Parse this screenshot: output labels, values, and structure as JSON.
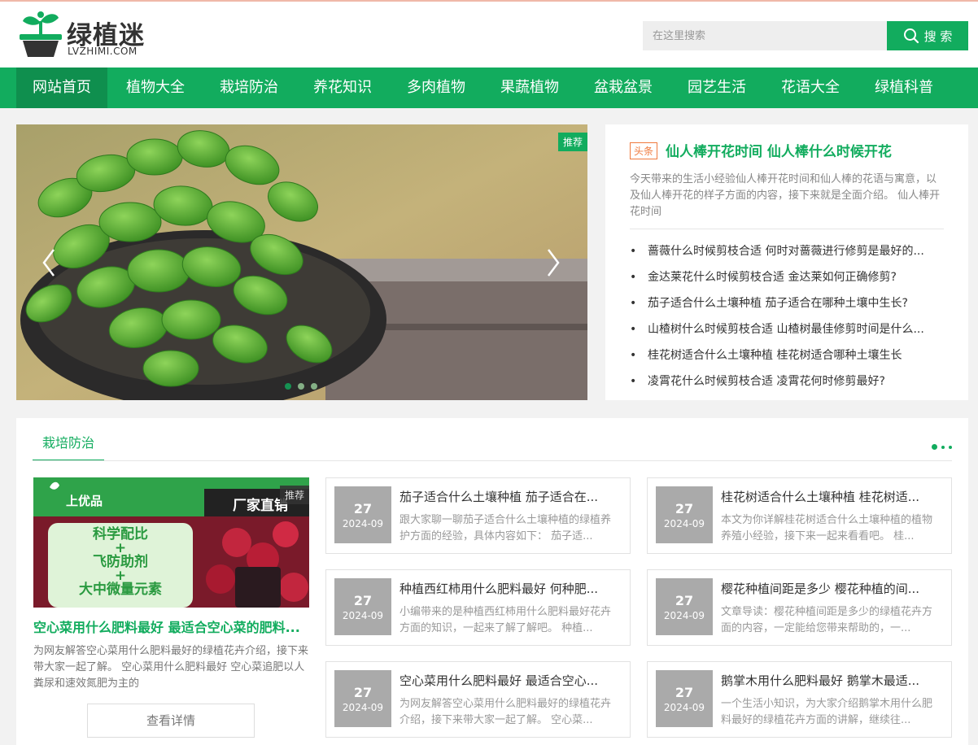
{
  "brand": {
    "name": "绿植迷",
    "domain": "LVZHIMI.COM",
    "accent": "#12ac5e",
    "logo_icon": "sprout-pot-icon"
  },
  "search": {
    "placeholder": "在这里搜索",
    "button_label": "搜 索"
  },
  "nav": {
    "items": [
      {
        "label": "网站首页",
        "active": true
      },
      {
        "label": "植物大全"
      },
      {
        "label": "栽培防治"
      },
      {
        "label": "养花知识"
      },
      {
        "label": "多肉植物"
      },
      {
        "label": "果蔬植物"
      },
      {
        "label": "盆栽盆景"
      },
      {
        "label": "园艺生活"
      },
      {
        "label": "花语大全"
      },
      {
        "label": "绿植科普"
      }
    ]
  },
  "slider": {
    "badge": "推荐",
    "image": "mint-plant-in-pot",
    "prev_icon": "chevron-left-icon",
    "next_icon": "chevron-right-icon"
  },
  "headline": {
    "badge": "头条",
    "title": "仙人棒开花时间 仙人棒什么时候开花",
    "summary": "今天带来的生活小经验仙人棒开花时间和仙人棒的花语与寓意，以及仙人棒开花的样子方面的内容，接下来就是全面介绍。 仙人棒开花时间",
    "list": [
      "蔷薇什么时候剪枝合适 何时对蔷薇进行修剪是最好的...",
      "金达莱花什么时候剪枝合适 金达莱如何正确修剪?",
      "茄子适合什么土壤种植 茄子适合在哪种土壤中生长?",
      "山楂树什么时候剪枝合适 山楂树最佳修剪时间是什么...",
      "桂花树适合什么土壤种植 桂花树适合哪种土壤生长",
      "凌霄花什么时候剪枝合适 凌霄花何时修剪最好?"
    ]
  },
  "section": {
    "tab": "栽培防治",
    "feature": {
      "badge": "推荐",
      "image_brand": "上优品",
      "image_tag": "厂家直销",
      "image_lines": [
        "科学配比",
        "+",
        "飞防助剂",
        "+",
        "大中微量元素"
      ],
      "title": "空心菜用什么肥料最好 最适合空心菜的肥料...",
      "desc": "为网友解答空心菜用什么肥料最好的绿植花卉介绍，接下来带大家一起了解。 空心菜用什么肥料最好 空心菜追肥以人粪尿和速效氮肥为主的",
      "button": "查看详情"
    },
    "cards": [
      {
        "day": "27",
        "ym": "2024-09",
        "title": "茄子适合什么土壤种植 茄子适合在...",
        "desc": "跟大家聊一聊茄子适合什么土壤种植的绿植养护方面的经验，具体内容如下： 茄子适..."
      },
      {
        "day": "27",
        "ym": "2024-09",
        "title": "桂花树适合什么土壤种植 桂花树适...",
        "desc": "本文为你详解桂花树适合什么土壤种植的植物养殖小经验，接下来一起来看看吧。 桂..."
      },
      {
        "day": "27",
        "ym": "2024-09",
        "title": "种植西红柿用什么肥料最好 何种肥...",
        "desc": "小编带来的是种植西红柿用什么肥料最好花卉方面的知识，一起来了解了解吧。 种植..."
      },
      {
        "day": "27",
        "ym": "2024-09",
        "title": "樱花种植间距是多少 樱花种植的间...",
        "desc": "文章导读：樱花种植间距是多少的绿植花卉方面的内容，一定能给您带来帮助的，一..."
      },
      {
        "day": "27",
        "ym": "2024-09",
        "title": "空心菜用什么肥料最好 最适合空心...",
        "desc": "为网友解答空心菜用什么肥料最好的绿植花卉介绍，接下来带大家一起了解。 空心菜..."
      },
      {
        "day": "27",
        "ym": "2024-09",
        "title": "鹅掌木用什么肥料最好 鹅掌木最适...",
        "desc": "一个生活小知识，为大家介绍鹅掌木用什么肥料最好的绿植花卉方面的讲解，继续往..."
      }
    ]
  }
}
